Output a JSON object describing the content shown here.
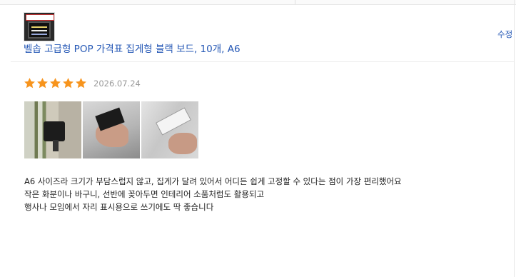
{
  "product": {
    "title": "벨솝 고급형 POP 가격표 집게형 블랙 보드, 10개, A6",
    "edit_label": "수정"
  },
  "review": {
    "rating": 5,
    "rating_max": 5,
    "date": "2026.07.24",
    "photo_count": 3,
    "lines": [
      "A6 사이즈라 크기가 부담스럽지 않고, 집게가 달려 있어서 어디든 쉽게 고정할 수 있다는 점이 가장 편리했어요",
      "작은 화분이나 바구니, 선반에 꽂아두면 인테리어 소품처럼도 활용되고",
      "행사나 모임에서 자리 표시용으로 쓰기에도 딱 좋습니다"
    ]
  },
  "colors": {
    "link": "#2457b5",
    "star": "#f7941d",
    "date": "#999999"
  }
}
